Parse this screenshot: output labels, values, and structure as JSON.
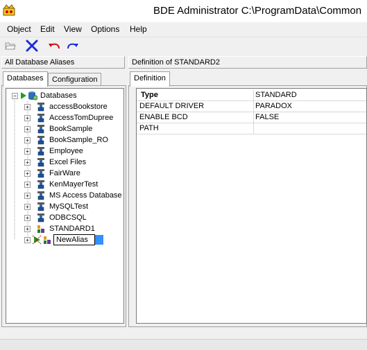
{
  "window": {
    "title": "BDE Administrator  C:\\ProgramData\\Common"
  },
  "menu": [
    "Object",
    "Edit",
    "View",
    "Options",
    "Help"
  ],
  "toolbar": {
    "open_icon": "folder-open-icon",
    "delete_icon": "delete-x-icon",
    "undo_icon": "undo-arrow-icon",
    "redo_icon": "redo-arrow-icon"
  },
  "left_pane": {
    "header": "All Database Aliases",
    "tabs": [
      "Databases",
      "Configuration"
    ],
    "active_tab": "Databases",
    "tree": {
      "root": "Databases",
      "items": [
        "accessBookstore",
        "AccessTomDupree",
        "BookSample",
        "BookSample_RO",
        "Employee",
        "Excel Files",
        "FairWare",
        "KenMayerTest",
        "MS Access Database",
        "MySQLTest",
        "ODBCSQL",
        "STANDARD1"
      ],
      "editing_item": "NewAlias"
    }
  },
  "right_pane": {
    "header": "Definition of STANDARD2",
    "tabs": [
      "Definition"
    ],
    "definition": [
      {
        "key": "Type",
        "value": "STANDARD"
      },
      {
        "key": "DEFAULT DRIVER",
        "value": "PARADOX"
      },
      {
        "key": "ENABLE BCD",
        "value": "FALSE"
      },
      {
        "key": "PATH",
        "value": ""
      }
    ]
  }
}
